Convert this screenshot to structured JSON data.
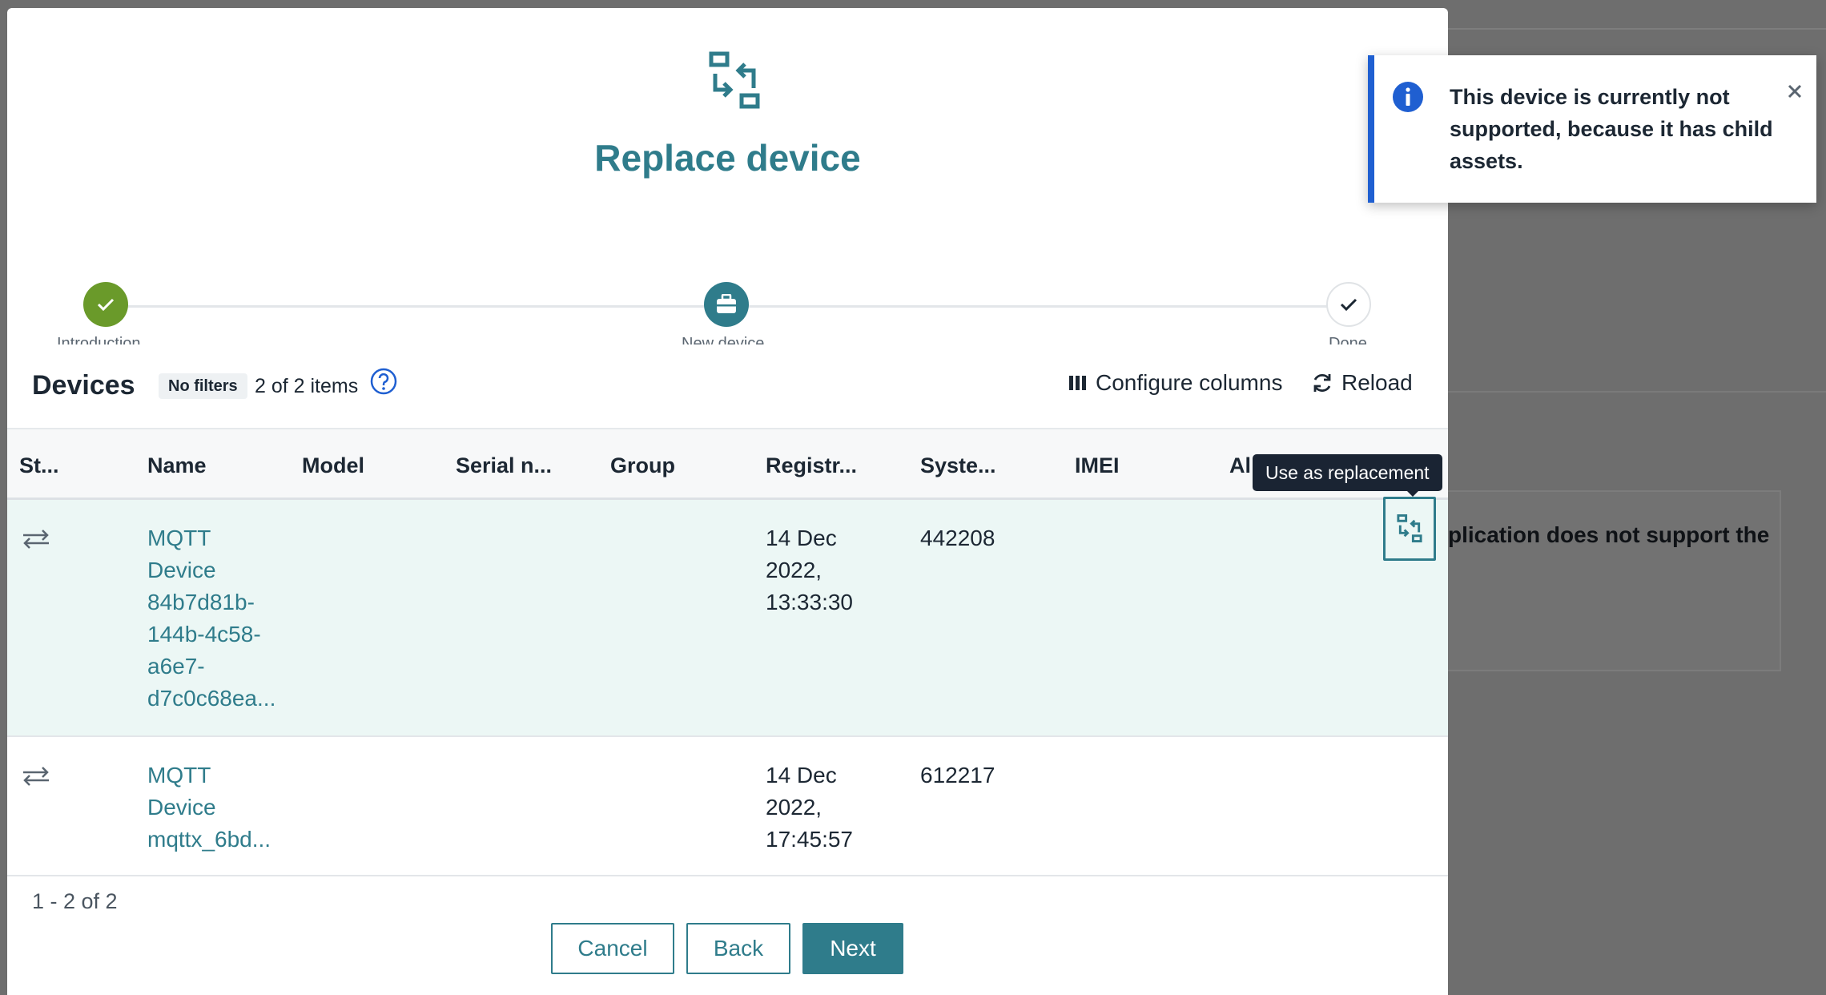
{
  "modal": {
    "title": "Replace device",
    "icon": "device-replace-icon"
  },
  "stepper": {
    "steps": [
      {
        "label": "Introduction",
        "state": "done",
        "icon": "check-icon"
      },
      {
        "label": "New device",
        "state": "active",
        "icon": "device-icon"
      },
      {
        "label": "Done",
        "state": "pending",
        "icon": "check-icon"
      }
    ]
  },
  "devices": {
    "title": "Devices",
    "filter_badge": "No filters",
    "count_text": "2 of 2 items",
    "configure_label": "Configure columns",
    "reload_label": "Reload",
    "columns": [
      "St...",
      "Name",
      "Model",
      "Serial n...",
      "Group",
      "Registr...",
      "Syste...",
      "IMEI",
      "Al"
    ],
    "rows": [
      {
        "status_icon": "transfer-arrows-icon",
        "name_lines": [
          "MQTT",
          "Device",
          "84b7d81b-",
          "144b-4c58-",
          "a6e7-",
          "d7c0c68ea..."
        ],
        "registration_lines": [
          "14 Dec",
          "2022,",
          "13:33:30"
        ],
        "system_id": "442208"
      },
      {
        "status_icon": "transfer-arrows-icon",
        "name_lines": [
          "MQTT",
          "Device",
          "mqttx_6bd..."
        ],
        "registration_lines": [
          "14 Dec",
          "2022,",
          "17:45:57"
        ],
        "system_id": "612217"
      }
    ],
    "pagination": "1 - 2 of 2",
    "tooltip": "Use as replacement"
  },
  "footer": {
    "cancel_label": "Cancel",
    "back_label": "Back",
    "next_label": "Next"
  },
  "toast": {
    "message": "This device is currently not supported, because it has child assets.",
    "type": "info"
  },
  "background": {
    "card_text": "plication does not support the"
  },
  "colors": {
    "primary": "#2f7c8b",
    "success": "#6a9a2a",
    "info": "#1f5fd1",
    "selected_row": "#ecf7f5",
    "tooltip_bg": "#1a2433"
  }
}
